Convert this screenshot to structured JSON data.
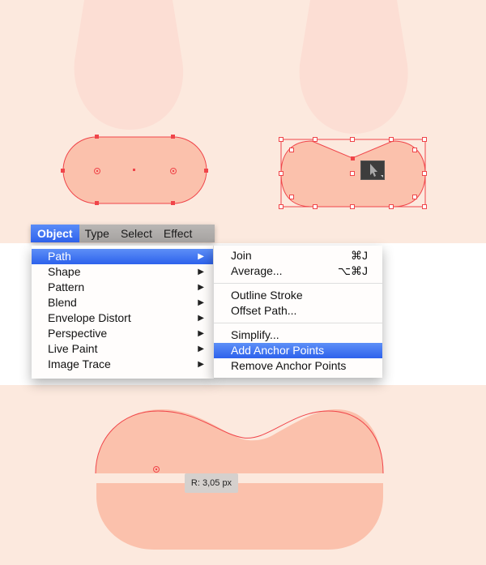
{
  "menubar": {
    "items": [
      {
        "label": "Object",
        "active": true
      },
      {
        "label": "Type",
        "active": false
      },
      {
        "label": "Select",
        "active": false
      },
      {
        "label": "Effect",
        "active": false
      }
    ]
  },
  "object_menu": {
    "items": [
      {
        "label": "Path",
        "submenu": true,
        "highlighted": true
      },
      {
        "label": "Shape",
        "submenu": true
      },
      {
        "label": "Pattern",
        "submenu": true
      },
      {
        "label": "Blend",
        "submenu": true
      },
      {
        "label": "Envelope Distort",
        "submenu": true
      },
      {
        "label": "Perspective",
        "submenu": true
      },
      {
        "label": "Live Paint",
        "submenu": true
      },
      {
        "label": "Image Trace",
        "submenu": true
      }
    ],
    "arrow_glyph": "▶"
  },
  "path_submenu": {
    "groups": [
      [
        {
          "label": "Join",
          "shortcut": "⌘J"
        },
        {
          "label": "Average...",
          "shortcut": "⌥⌘J"
        }
      ],
      [
        {
          "label": "Outline Stroke",
          "shortcut": ""
        },
        {
          "label": "Offset Path...",
          "shortcut": ""
        }
      ],
      [
        {
          "label": "Simplify...",
          "shortcut": ""
        },
        {
          "label": "Add Anchor Points",
          "shortcut": "",
          "highlighted": true
        },
        {
          "label": "Remove Anchor Points",
          "shortcut": ""
        }
      ]
    ]
  },
  "tooltip": {
    "text": "R: 3,05 px"
  },
  "colors": {
    "canvas": "#fce9de",
    "shape_fill": "#fbc1ac",
    "light_shape": "#fcded4",
    "path_stroke": "#f0454a",
    "menu_highlight": "#3a6ff0"
  }
}
